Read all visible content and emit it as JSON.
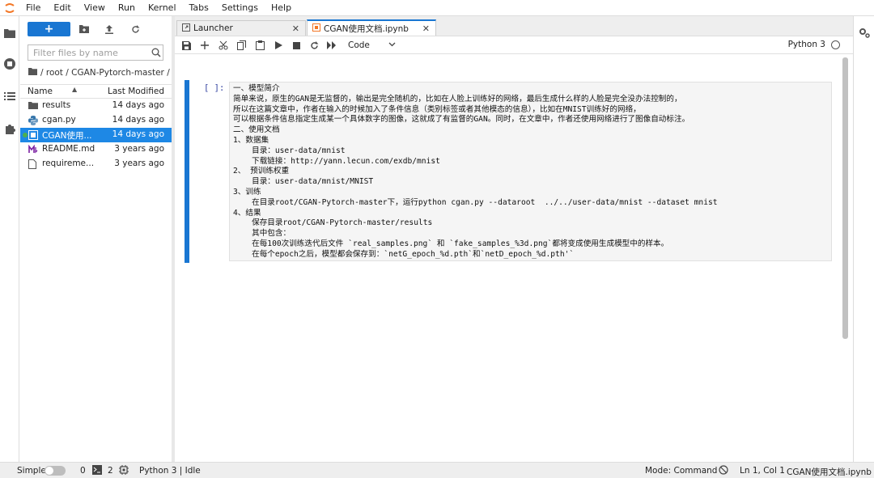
{
  "menubar": {
    "items": [
      "File",
      "Edit",
      "View",
      "Run",
      "Kernel",
      "Tabs",
      "Settings",
      "Help"
    ]
  },
  "filebrowser": {
    "new_button_label": "+",
    "filter_placeholder": "Filter files by name",
    "breadcrumb": "/ root / CGAN-Pytorch-master /",
    "header_name": "Name",
    "header_sort": "▲",
    "header_modified": "Last Modified",
    "files": [
      {
        "name": "results",
        "modified": "14 days ago",
        "icon": "folder-icon"
      },
      {
        "name": "cgan.py",
        "modified": "14 days ago",
        "icon": "python-file-icon"
      },
      {
        "name": "CGAN使用...",
        "modified": "14 days ago",
        "icon": "notebook-icon"
      },
      {
        "name": "README.md",
        "modified": "3 years ago",
        "icon": "markdown-icon"
      },
      {
        "name": "requireme...",
        "modified": "3 years ago",
        "icon": "file-icon"
      }
    ]
  },
  "tabs": [
    {
      "label": "Launcher",
      "icon": "launcher-icon"
    },
    {
      "label": "CGAN使用文档.ipynb",
      "icon": "notebook-icon"
    }
  ],
  "notebook": {
    "cell_type": "Code",
    "kernel": "Python 3",
    "prompt": "[ ]:",
    "lines": [
      "一、模型简介",
      "简单来说，原生的GAN是无监督的，输出是完全随机的，比如在人脸上训练好的网络，最后生成什么样的人脸是完全没办法控制的，",
      "所以在这篇文章中，作者在输入的时候加入了条件信息（类别标签或者其他模态的信息），比如在MNIST训练好的网络，",
      "可以根据条件信息指定生成某一个具体数字的图像，这就成了有监督的GAN。同时，在文章中，作者还使用网络进行了图像自动标注。",
      "二、使用文档",
      "1、数据集",
      "    目录：user-data/mnist",
      "    下载链接：http://yann.lecun.com/exdb/mnist",
      "2、 预训练权重",
      "    目录：user-data/mnist/MNIST",
      "3、训练",
      "    在目录root/CGAN-Pytorch-master下，运行python cgan.py --dataroot  ../../user-data/mnist --dataset mnist",
      "4、结果",
      "    保存目录root/CGAN-Pytorch-master/results",
      "    其中包含：",
      "    在每100次训练迭代后文件 `real_samples.png` 和 `fake_samples_%3d.png`都将变成使用生成模型中的样本。",
      "    在每个epoch之后，模型都会保存到：`netG_epoch_%d.pth`和`netD_epoch_%d.pth'`"
    ]
  },
  "statusbar": {
    "simple": "Simple",
    "terminals": "0",
    "kernels": "2",
    "kernel_status": "Python 3 | Idle",
    "mode": "Mode: Command",
    "position": "Ln 1, Col 1",
    "filename": "CGAN使用文档.ipynb"
  },
  "colors": {
    "accent": "#1976d2",
    "selected_row": "#1e88e5",
    "running": "#4caf50"
  }
}
